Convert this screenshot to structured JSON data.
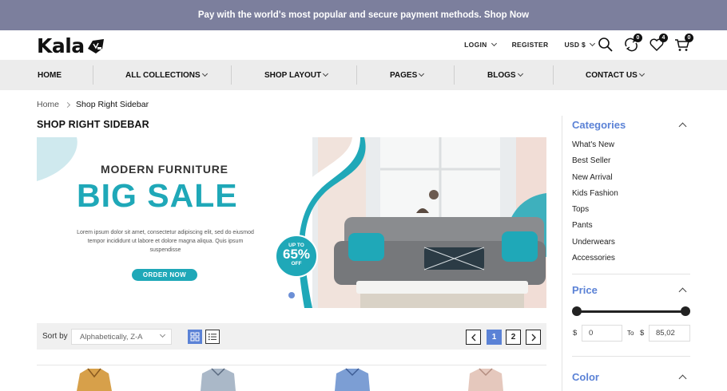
{
  "promo": {
    "text": "Pay with the world's most popular and secure payment methods. Shop Now"
  },
  "header": {
    "logo_text": "Kala",
    "links": {
      "login": "LOGIN",
      "register": "REGISTER",
      "currency": "USD $"
    },
    "badges": {
      "compare": "0",
      "wishlist": "4",
      "cart": "0"
    }
  },
  "nav": {
    "items": [
      {
        "label": "HOME"
      },
      {
        "label": "ALL COLLECTIONS"
      },
      {
        "label": "SHOP LAYOUT"
      },
      {
        "label": "PAGES"
      },
      {
        "label": "BLOGS"
      },
      {
        "label": "CONTACT US"
      }
    ]
  },
  "breadcrumb": {
    "home": "Home",
    "current": "Shop Right Sidebar"
  },
  "page_title": "SHOP RIGHT SIDEBAR",
  "banner": {
    "subtitle": "MODERN FURNITURE",
    "title": "BIG SALE",
    "text": "Lorem ipsum dolor sit amet, consectetur adipiscing elit, sed do eiusmod tempor incididunt ut labore et dolore magna aliqua. Quis ipsum suspendisse",
    "button": "ORDER NOW",
    "offer_top": "UP TO",
    "offer_value": "65%",
    "offer_bottom": "OFF"
  },
  "toolbar": {
    "sort_label": "Sort by",
    "sort_value": "Alphabetically, Z-A",
    "pages": [
      "1",
      "2"
    ],
    "active_page": "1"
  },
  "sidebar": {
    "categories_title": "Categories",
    "categories": [
      "What's New",
      "Best Seller",
      "New Arrival",
      "Kids Fashion",
      "Tops",
      "Pants",
      "Underwears",
      "Accessories"
    ],
    "price_title": "Price",
    "price_currency": "$",
    "price_to": "To",
    "price_min": "0",
    "price_max": "85,02",
    "color_title": "Color"
  },
  "colors": {
    "accent": "#5b82d6",
    "teal": "#1fa8b8",
    "promo_bg": "#7c7f9d"
  }
}
